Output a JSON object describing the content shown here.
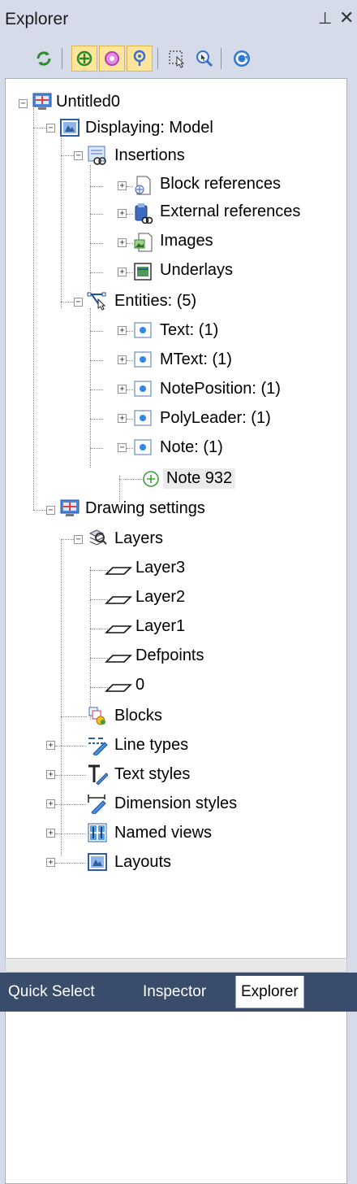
{
  "window": {
    "title": "Explorer",
    "pin_glyph": "⊥",
    "close_glyph": "✕"
  },
  "toolbar": {
    "buttons": [
      {
        "name": "refresh-icon",
        "active": false
      },
      {
        "name": "show-insertions-icon",
        "active": true
      },
      {
        "name": "show-entities-icon",
        "active": true
      },
      {
        "name": "show-settings-icon",
        "active": true
      },
      {
        "name": "select-entities-icon",
        "active": false
      },
      {
        "name": "zoom-to-icon",
        "active": false
      },
      {
        "name": "help-icon",
        "active": false
      }
    ]
  },
  "tree": {
    "root": "Untitled0",
    "displaying": "Displaying: Model",
    "insertions": "Insertions",
    "block_references": "Block references",
    "external_references": "External references",
    "images": "Images",
    "underlays": "Underlays",
    "entities": "Entities: (5)",
    "text": "Text: (1)",
    "mtext": "MText: (1)",
    "noteposition": "NotePosition: (1)",
    "polyleader": "PolyLeader: (1)",
    "note": "Note: (1)",
    "note_item": "Note 932",
    "drawing_settings": "Drawing settings",
    "layers": "Layers",
    "layer3": "Layer3",
    "layer2": "Layer2",
    "layer1": "Layer1",
    "defpoints": "Defpoints",
    "layer0": "0",
    "blocks": "Blocks",
    "line_types": "Line types",
    "text_styles": "Text styles",
    "dimension_styles": "Dimension styles",
    "named_views": "Named views",
    "layouts": "Layouts"
  },
  "tabs": [
    "Quick Select",
    "Inspector",
    "Explorer"
  ],
  "active_tab": "Explorer",
  "colors": {
    "accent_active": "#fde59b",
    "tabbar": "#3a4c6b",
    "selection": "#ebebeb"
  }
}
